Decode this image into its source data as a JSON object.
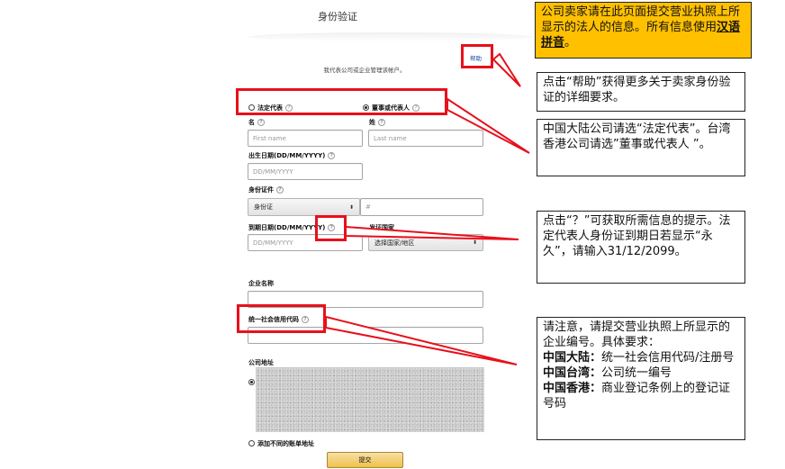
{
  "form": {
    "title": "身份验证",
    "help_label": "帮助",
    "subtitle": "我代表公司或企业管理该帐户。",
    "role_options": [
      {
        "label": "法定代表",
        "selected": false
      },
      {
        "label": "董事或代表人",
        "selected": true
      }
    ],
    "help_symbol": "?",
    "first_name_label": "名",
    "last_name_label": "姓",
    "first_name_placeholder": "First name",
    "last_name_placeholder": "Last name",
    "dob_label": "出生日期(DD/MM/YYYY)",
    "dob_placeholder": "DD/MM/YYYY",
    "id_label": "身份证件",
    "id_type_value": "身份证",
    "id_number_placeholder": "#",
    "expiry_label": "到期日期(DD/MM/YYYY)",
    "expiry_placeholder": "DD/MM/YYYY",
    "issuing_country_label": "发证国家",
    "issuing_country_value": "选择国家/地区",
    "company_name_label": "企业名称",
    "credit_code_label": "统一社会信用代码",
    "address_label": "公司地址",
    "add_address_label": "添加不同的账单地址",
    "submit_label": "提交"
  },
  "annotations": {
    "intro": {
      "part1": "公司卖家请在此页面提交营业执照上所显示的法人的信息。所有信息使用",
      "emphasis": "汉语拼音",
      "part2": "。"
    },
    "help": "点击“帮助”获得更多关于卖家身份验证的详细要求。",
    "role": "中国大陆公司请选“法定代表”。台湾香港公司请选”董事或代表人 ”。",
    "question": "点击“？”可获取所需信息的提示。法定代表人身份证到期日若显示“永久”，请输入31/12/2099。",
    "registration": {
      "intro": "请注意，请提交营业执照上所显示的企业编号。具体要求：",
      "items": [
        {
          "region": "中国大陆：",
          "text": "统一社会信用代码/注册号"
        },
        {
          "region": "中国台湾：",
          "text": "公司统一编号"
        },
        {
          "region": "中国香港：",
          "text": "商业登记条例上的登记证号码"
        }
      ]
    }
  },
  "colors": {
    "highlight": "#e8101a",
    "intro_background": "#ffc000",
    "submit_button": "#f0c14b",
    "help_link": "#1a4fa0"
  }
}
